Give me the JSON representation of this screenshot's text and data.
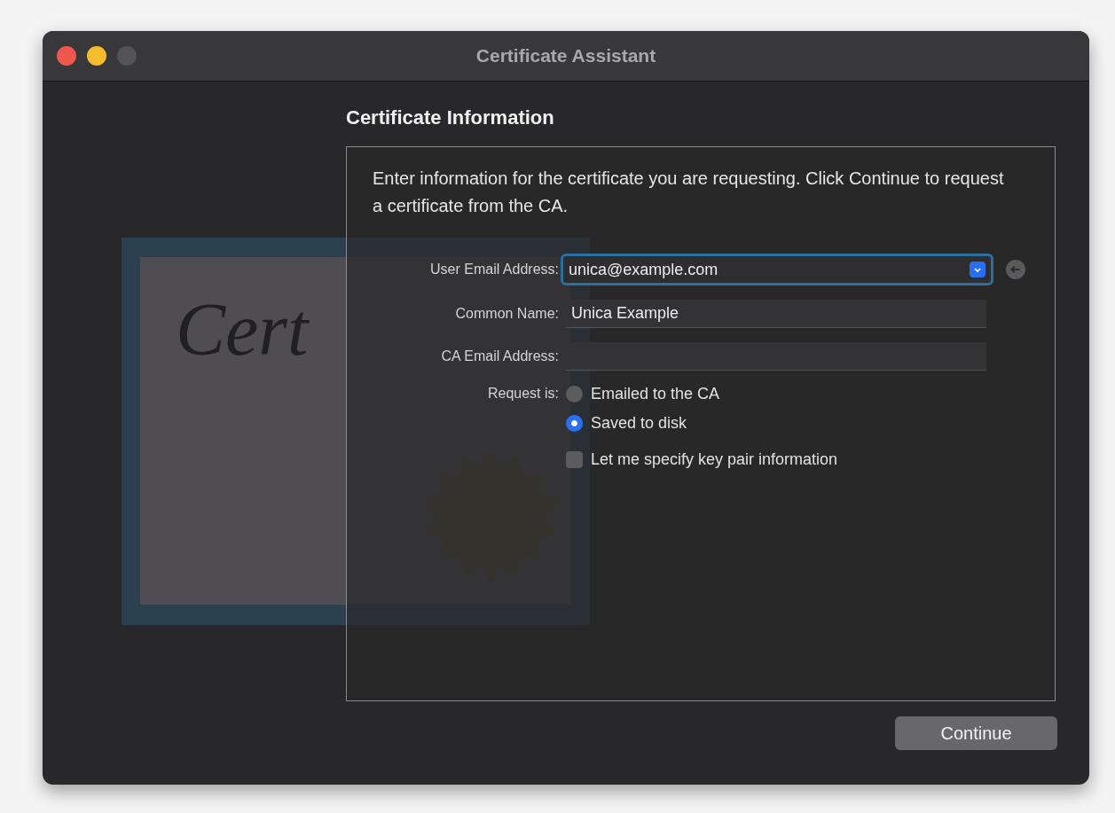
{
  "window": {
    "title": "Certificate Assistant"
  },
  "artwork": {
    "text": "Cert"
  },
  "heading": "Certificate Information",
  "intro": "Enter information for the certificate you are requesting. Click Continue to request a certificate from the CA.",
  "fields": [
    {
      "label": "User Email Address:",
      "value": "unica@example.com",
      "kind": "combo",
      "focused": true
    },
    {
      "label": "Common Name:",
      "value": "Unica Example",
      "kind": "text",
      "focused": false
    },
    {
      "label": "CA Email Address:",
      "kind": "text",
      "focused": false
    }
  ],
  "request": {
    "label": "Request is:",
    "options": [
      {
        "label": "Emailed to the CA",
        "selected": false
      },
      {
        "label": "Saved to disk",
        "selected": true
      }
    ]
  },
  "key_pair": {
    "label": "Let me specify key pair information",
    "checked": false
  },
  "buttons": [
    {
      "label": "Continue"
    }
  ]
}
